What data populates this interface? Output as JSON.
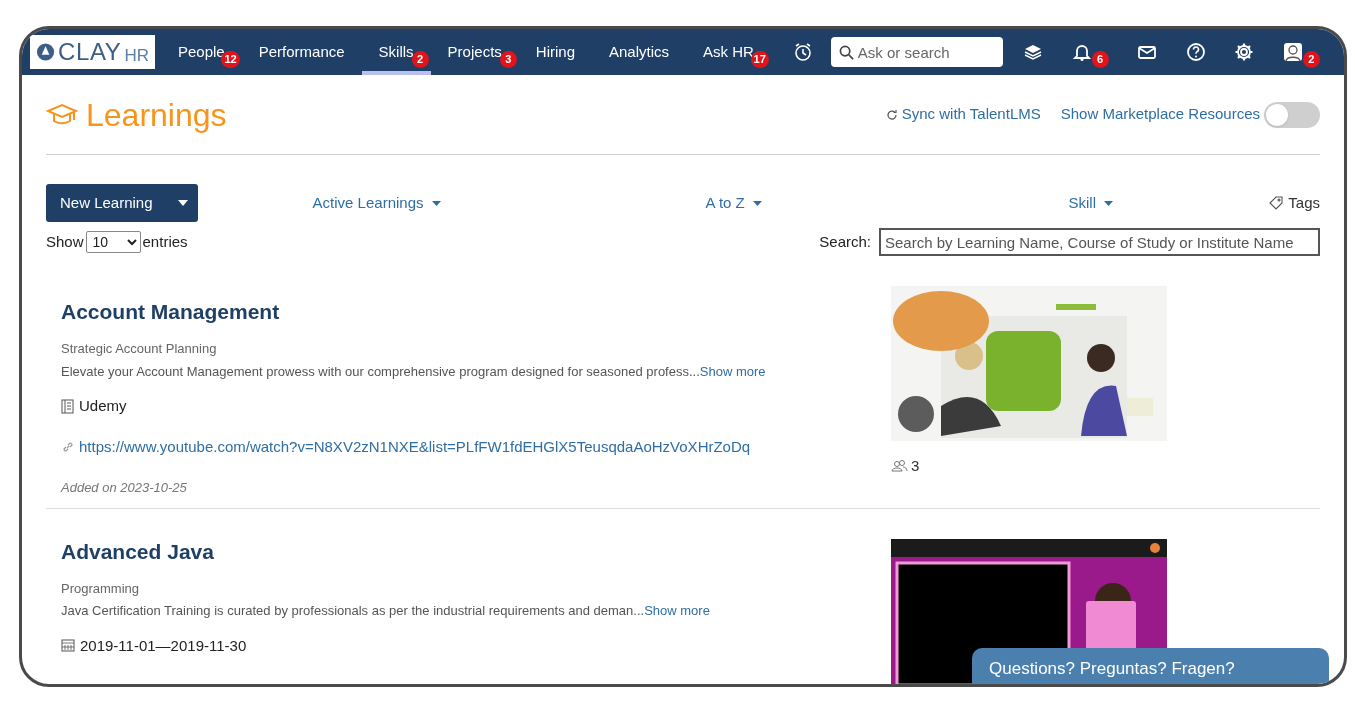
{
  "logo": {
    "text": "CLAY",
    "suffix": "HR"
  },
  "nav": [
    {
      "label": "People",
      "badge": "12",
      "selected": false
    },
    {
      "label": "Performance",
      "selected": false
    },
    {
      "label": "Skills",
      "badge": "2",
      "selected": true
    },
    {
      "label": "Projects",
      "badge": "3",
      "selected": false
    },
    {
      "label": "Hiring",
      "selected": false
    },
    {
      "label": "Analytics",
      "selected": false
    },
    {
      "label": "Ask HR",
      "badge": "17",
      "selected": false
    }
  ],
  "search": {
    "placeholder": "Ask or search"
  },
  "nav_icons": [
    {
      "kind": "layers"
    },
    {
      "kind": "bell",
      "badge": "6"
    },
    {
      "kind": "mail"
    },
    {
      "kind": "help"
    },
    {
      "kind": "settings"
    },
    {
      "kind": "avatar",
      "badge": "2"
    }
  ],
  "page": {
    "title": "Learnings",
    "sync_link": "Sync with TalentLMS",
    "marketplace": {
      "label": "Show Marketplace Resources",
      "on": false
    }
  },
  "toolbar": {
    "new_button": "New Learning",
    "filters": [
      "Active Learnings",
      "A to Z",
      "Skill"
    ],
    "tags": "Tags"
  },
  "table_controls": {
    "show": "Show",
    "entries_value": "10",
    "entries": "entries",
    "search_label": "Search:",
    "search_placeholder": "Search by Learning Name, Course of Study or Institute Name"
  },
  "learnings": [
    {
      "title": "Account Management",
      "category": "Strategic Account Planning",
      "description": "Elevate your Account Management prowess with our comprehensive program designed for seasoned profess...",
      "show_more": "Show more",
      "provider": "Udemy",
      "url": "https://www.youtube.com/watch?v=N8XV2zN1NXE&list=PLfFW1fdEHGlX5TeusqdaAoHzVoXHrZoDq",
      "added": "Added on 2023-10-25",
      "attendees": "3"
    },
    {
      "title": "Advanced Java",
      "category": "Programming",
      "description": "Java Certification Training is curated by professionals as per the industrial requirements and deman...",
      "show_more": "Show more",
      "dates": "2019-11-01—2019-11-30"
    }
  ],
  "chat_widget": "Questions? Preguntas? Fragen?"
}
